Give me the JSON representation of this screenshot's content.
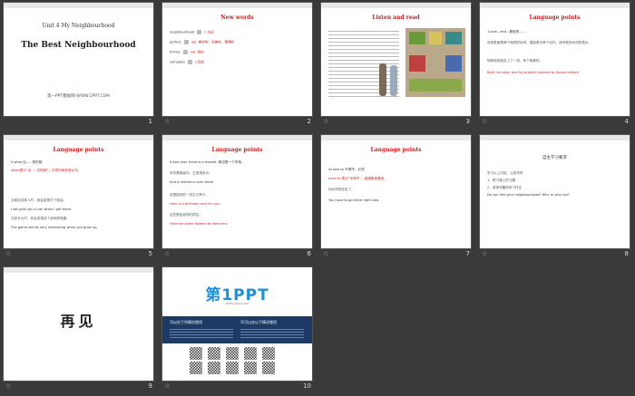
{
  "slides": [
    {
      "num": "1",
      "unit": "Unit 4 My  Neighbourhood",
      "title": "The Best Neighbourhood",
      "footer": "第一PPT模板网-WWW.1PPT.COM"
    },
    {
      "num": "2",
      "title": "New words",
      "words": [
        {
          "en": "neighbourhood",
          "cn": "n.邻近"
        },
        {
          "en": "perfect",
          "cn": "adj. 美好的；完美的，理想的"
        },
        {
          "en": "thirsty",
          "cn": "adj. 渴的"
        },
        {
          "en": "complete",
          "cn": "v.完成"
        }
      ]
    },
    {
      "num": "3",
      "title": "Listen and read"
    },
    {
      "num": "4",
      "title": "Language points",
      "p1": "1.look...and...看谁的......",
      "p2": "该用表面是两个相同的动词，直接表示两个动作。该有很多动词的表示。",
      "p3": "他和他的朋友上了一张，有个故事的。",
      "p4": "Both his sister and his brother listened to Haoser before."
    },
    {
      "num": "5",
      "title": "Language points",
      "l1": "2.when当......的时候",
      "l2": "when表示\"当......的时候\"，引导时间状语从句。",
      "l3": "当我见到某人时，我会给他打个电话。",
      "l4": "I will give you a call when I get there.",
      "l5": "当你长大时，你会发现这个游戏很有趣。",
      "l6": "The game will be very interesting when you grow up."
    },
    {
      "num": "6",
      "title": "Language points",
      "l1": "3.And over there is a market. 那边是一个市场。",
      "l2": "本句是倒装句，正常语序为：",
      "l3": "And a market is over there.",
      "l4": "这是给你的一张生日贺卡。",
      "l5": "Here is a birthday card for you.",
      "l6": "这些是给老师们的花。",
      "l7": "Here are some flowers for teachers."
    },
    {
      "num": "7",
      "title": "Language points",
      "l1": "4.have to 不得不，必须",
      "l2": "have to 表示\"不得不\"，强调客观原因。",
      "l3": "你必须现在走了。",
      "l4": "You have to go there right now."
    },
    {
      "num": "8",
      "title": "自主学习要求",
      "l1": "学习以上内容，认真写好",
      "l2": "1、预习课上的习题",
      "l3": "2、老师布置的练习作业",
      "l4": "Do you like your neighbourhood? Why or why not?"
    },
    {
      "num": "9",
      "title": "再见"
    },
    {
      "num": "10",
      "logo": "第1PPT",
      "tagline": "www.1ppt.com",
      "col1": "可以在下列情况使用",
      "col2": "不可以在以下情况使用"
    }
  ],
  "star": "☆"
}
